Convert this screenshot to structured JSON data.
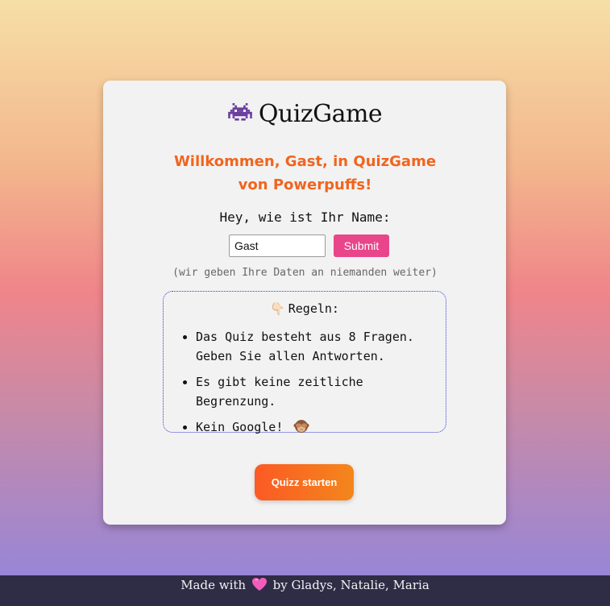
{
  "header": {
    "logo_icon": "alien-monster-icon",
    "title": "QuizGame"
  },
  "welcome": {
    "text": "Willkommen, Gast, in QuizGame von Powerpuffs!"
  },
  "form": {
    "question": "Hey, wie ist Ihr Name:",
    "name_value": "Gast",
    "submit_label": "Submit",
    "privacy_note": "(wir geben Ihre Daten an niemanden weiter)"
  },
  "rules": {
    "title_icon": "pointing-down-hand-icon",
    "title": "Regeln:",
    "items": [
      {
        "line1": "Das Quiz besteht aus 8 Fragen.",
        "line2": "Geben Sie allen Antworten."
      },
      {
        "line1": "Es gibt keine zeitliche Begrenzung."
      },
      {
        "line1": "Kein Google!",
        "icon": "see-no-evil-monkey-icon"
      }
    ]
  },
  "start_button": {
    "label": "Quizz starten"
  },
  "footer": {
    "prefix": "Made with",
    "icon": "pink-heart-icon",
    "suffix": "by Gladys, Natalie, Maria"
  },
  "colors": {
    "accent_orange": "#f0651e",
    "submit_pink": "#e9458a",
    "footer_bg": "#2f2c46",
    "rules_border": "#3a3ad8"
  }
}
